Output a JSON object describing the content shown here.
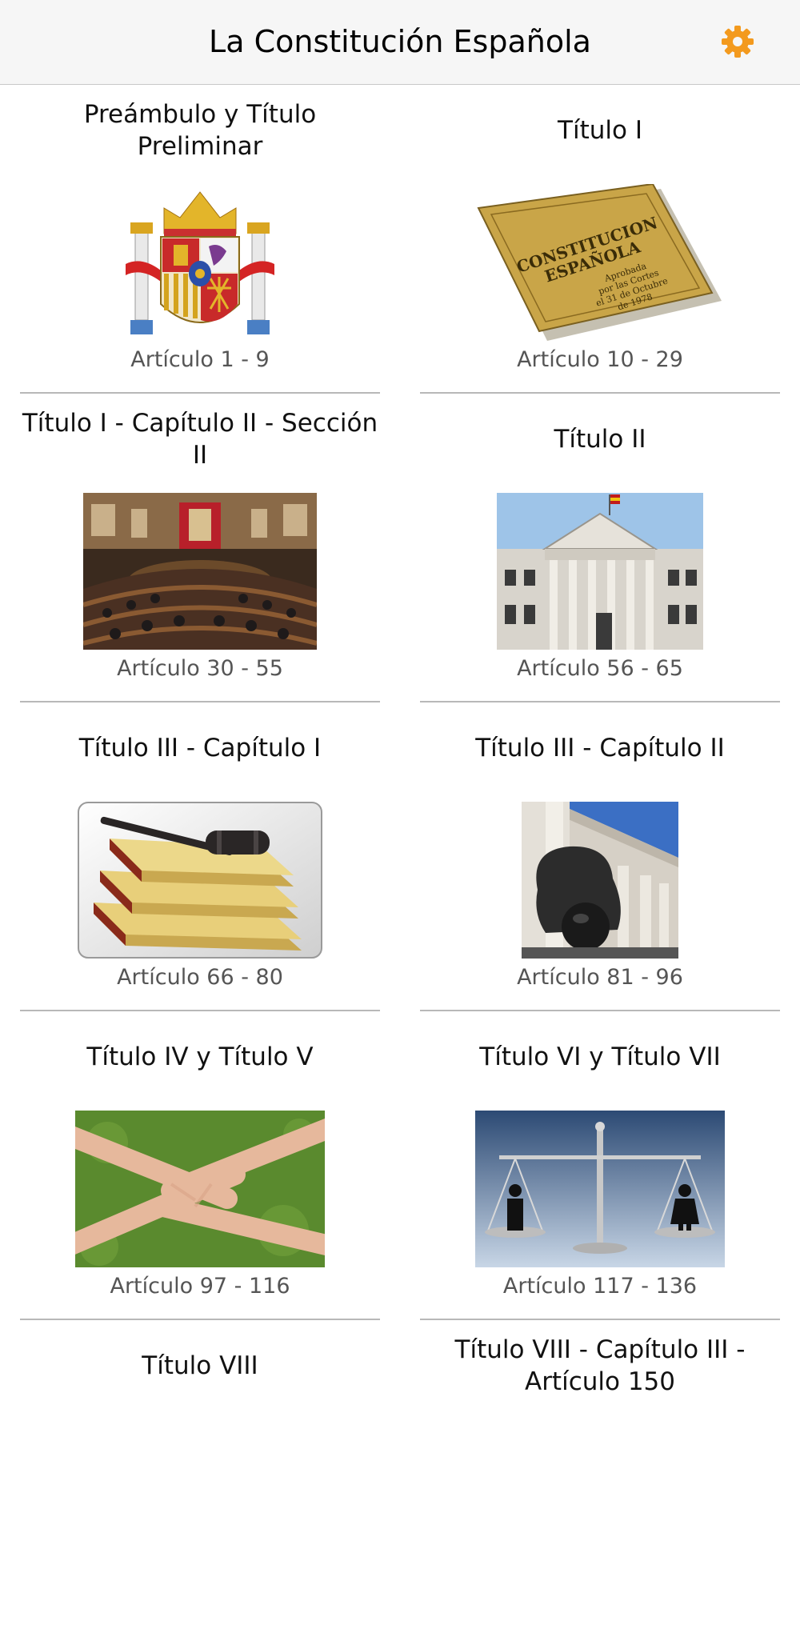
{
  "header": {
    "title": "La Constitución Española",
    "settings_icon": "gear-icon",
    "accent_color": "#f39a1e"
  },
  "sections": [
    {
      "title": "Preámbulo y Título Preliminar",
      "range": "Artículo 1 - 9",
      "image": "coat-of-arms-of-spain"
    },
    {
      "title": "Título I",
      "range": "Artículo 10 - 29",
      "image": "constitution-book-cover"
    },
    {
      "title": "Título I - Capítulo II - Sección II",
      "range": "Artículo 30 - 55",
      "image": "parliament-chamber-photo"
    },
    {
      "title": "Título II",
      "range": "Artículo 56 - 65",
      "image": "congress-building-facade-photo"
    },
    {
      "title": "Título III - Capítulo I",
      "range": "Artículo 66 - 80",
      "image": "gavel-on-law-books"
    },
    {
      "title": "Título III - Capítulo II",
      "range": "Artículo 81 - 96",
      "image": "lion-statue-congress-photo"
    },
    {
      "title": "Título IV y Título V",
      "range": "Artículo 97 - 116",
      "image": "linked-hands-on-grass"
    },
    {
      "title": "Título VI y Título VII",
      "range": "Artículo 117 - 136",
      "image": "balance-scale"
    },
    {
      "title": "Título VIII",
      "range": "",
      "image": ""
    },
    {
      "title": "Título VIII - Capítulo III - Artículo 150",
      "range": "",
      "image": ""
    }
  ],
  "cover_book": {
    "line1": "CONSTITUCION",
    "line2": "ESPAÑOLA",
    "line3": "Aprobada",
    "line4": "por las Cortes",
    "line5": "el 31 de Octubre",
    "line6": "de 1978"
  }
}
